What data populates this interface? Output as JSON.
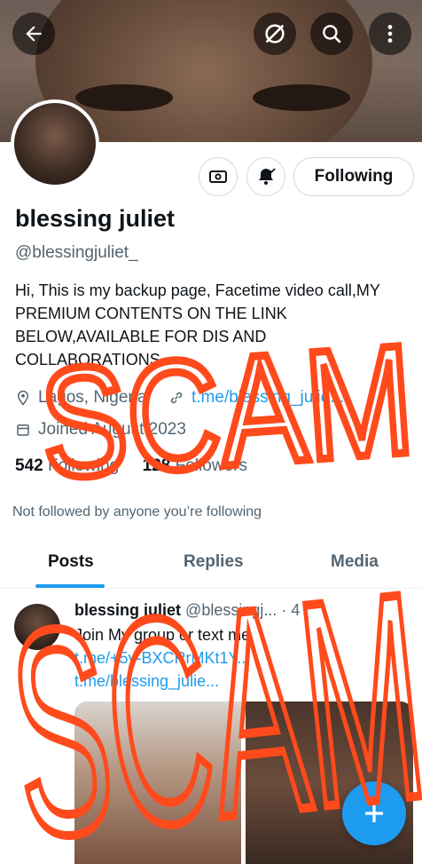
{
  "profile": {
    "name": "blessing juliet",
    "handle": "@blessingjuliet_",
    "bio": "Hi, This is my backup page, Facetime video call,MY PREMIUM CONTENTS ON THE LINK BELOW,AVAILABLE FOR DIS AND COLLABORATIONS",
    "location": "Lagos, Nigeria",
    "link": "t.me/blessing_julie...",
    "joined": "Joined August 2023",
    "following_count": "542",
    "following_label": "Following",
    "followers_count": "128",
    "followers_label": "Followers",
    "not_followed": "Not followed by anyone you’re following"
  },
  "actions": {
    "following_button": "Following"
  },
  "tabs": [
    {
      "label": "Posts"
    },
    {
      "label": "Replies"
    },
    {
      "label": "Media"
    }
  ],
  "post": {
    "author": "blessing juliet",
    "handle": "@blessingj...",
    "time": "· 4",
    "line1": "Join My group or text me",
    "line2": "t.me/+5y-BXCRrMKt1Y...",
    "line3": "t.me/blessing_julie..."
  },
  "overlay_text": "SCAM",
  "colors": {
    "accent": "#1d9bf0",
    "overlay": "#ff4a1c"
  },
  "icons": [
    "back-arrow-icon",
    "no-preview-icon",
    "search-icon",
    "more-vertical-icon",
    "monetize-icon",
    "bell-check-icon",
    "location-icon",
    "link-icon",
    "calendar-icon",
    "compose-plus-icon"
  ]
}
